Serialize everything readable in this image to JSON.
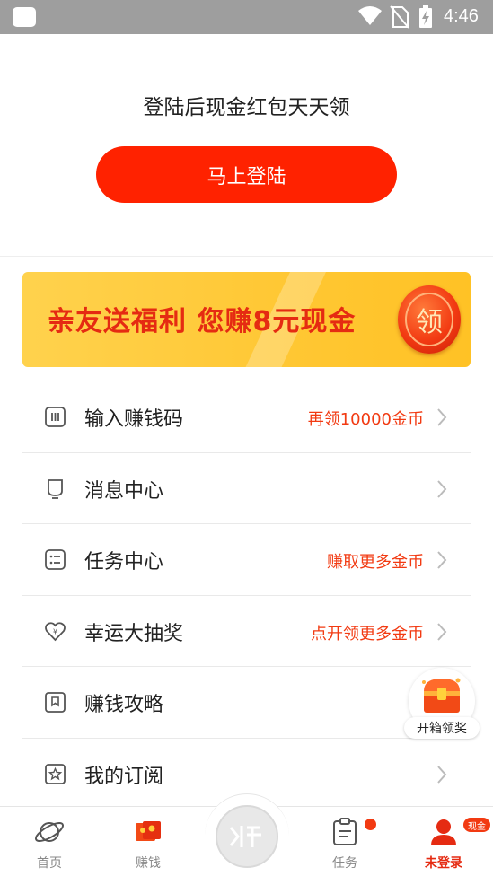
{
  "status_bar": {
    "time": "4:46"
  },
  "login": {
    "prompt": "登陆后现金红包天天领",
    "button_label": "马上登陆"
  },
  "banner": {
    "text": "亲友送福利 您赚8元现金",
    "coin_label": "领"
  },
  "menu": [
    {
      "label": "输入赚钱码",
      "hint": "再领10000金币",
      "icon": "code-icon"
    },
    {
      "label": "消息中心",
      "hint": "",
      "icon": "bell-icon"
    },
    {
      "label": "任务中心",
      "hint": "赚取更多金币",
      "icon": "task-list-icon"
    },
    {
      "label": "幸运大抽奖",
      "hint": "点开领更多金币",
      "icon": "lucky-heart-icon"
    },
    {
      "label": "赚钱攻略",
      "hint": "",
      "icon": "guide-book-icon"
    },
    {
      "label": "我的订阅",
      "hint": "",
      "icon": "subscription-star-icon"
    }
  ],
  "floating": {
    "chest_label": "开箱领奖"
  },
  "tab_bar": {
    "tabs": [
      {
        "label": "首页",
        "icon": "planet-icon",
        "active": false
      },
      {
        "label": "赚钱",
        "icon": "red-envelope-icon",
        "active": false
      },
      {
        "label": "任务",
        "icon": "task-clipboard-icon",
        "active": false
      },
      {
        "label": "未登录",
        "icon": "user-icon",
        "active": true
      }
    ],
    "center_icon": "listen-icon",
    "cash_badge": "现金"
  },
  "colors": {
    "accent": "#ff2200",
    "hint_red": "#f23a12",
    "banner_yellow": "#ffc733",
    "status_bar": "#9e9e9e"
  }
}
